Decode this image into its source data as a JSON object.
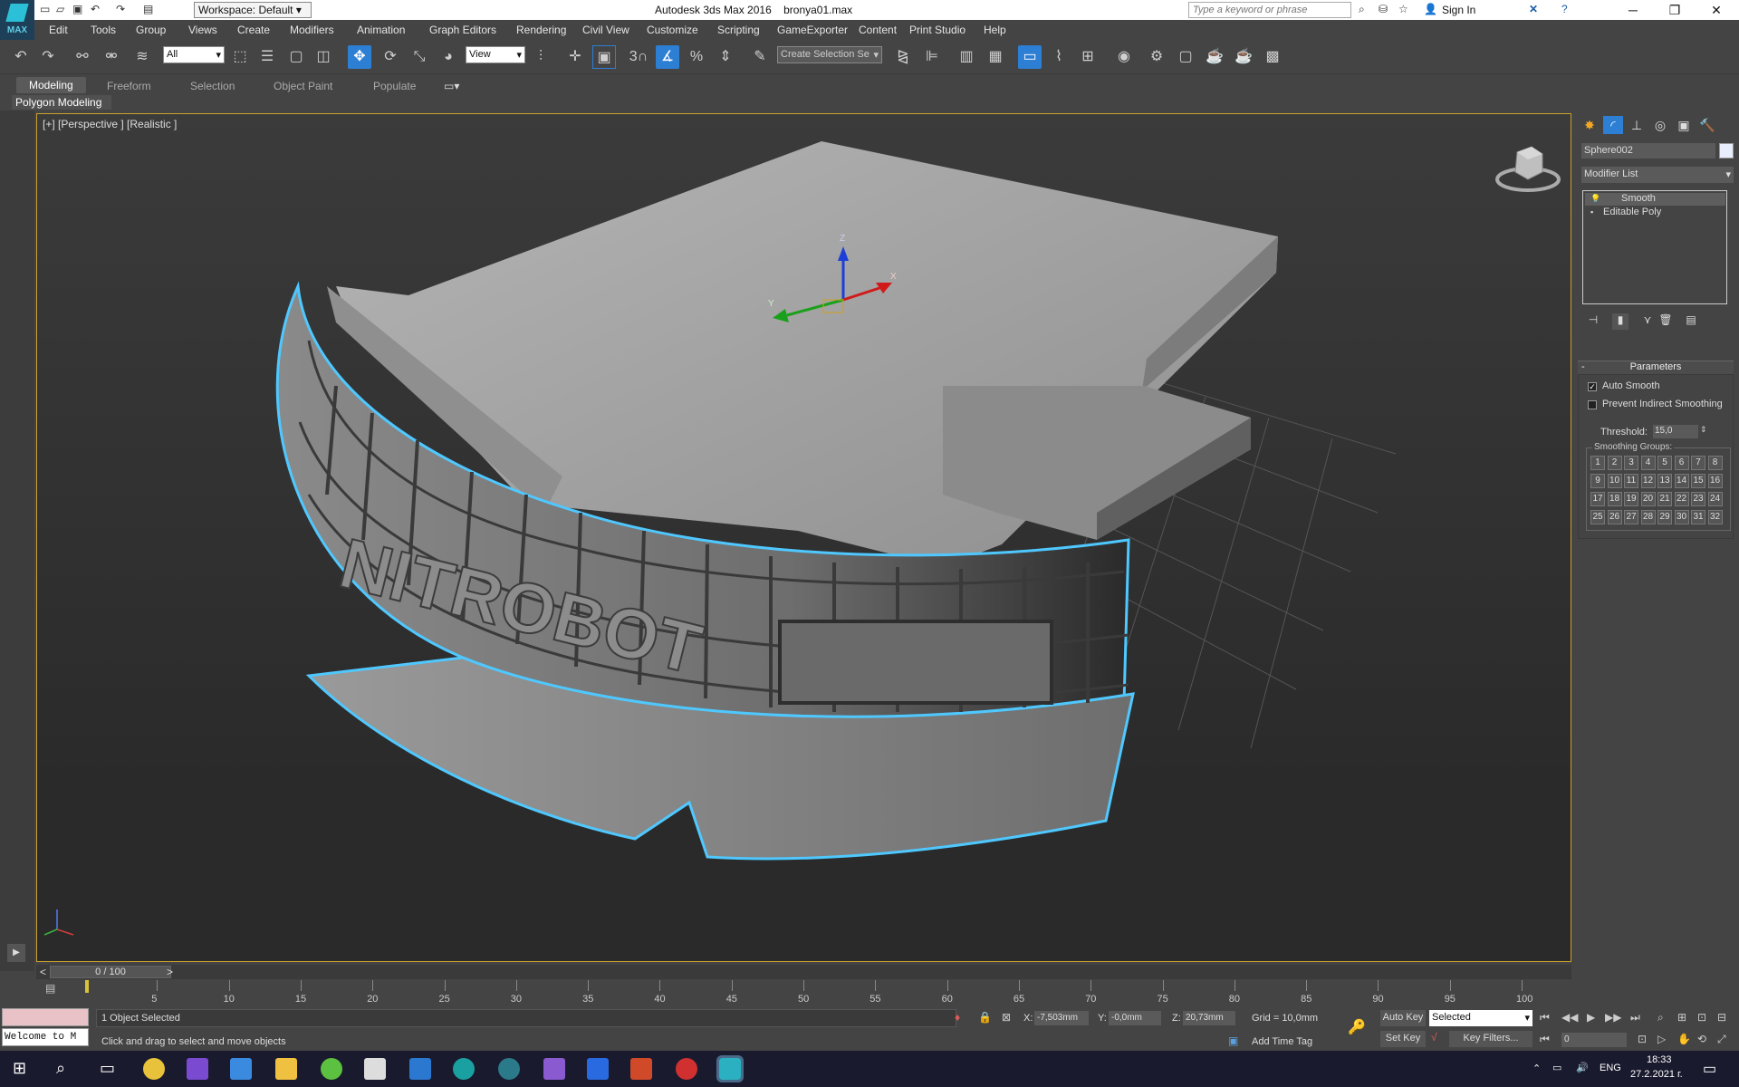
{
  "titlebar": {
    "logo_text": "MAX",
    "workspace": "Workspace: Default",
    "app_title": "Autodesk 3ds Max 2016",
    "file_name": "bronya01.max",
    "search_placeholder": "Type a keyword or phrase",
    "sign_in": "Sign In"
  },
  "menu": [
    "Edit",
    "Tools",
    "Group",
    "Views",
    "Create",
    "Modifiers",
    "Animation",
    "Graph Editors",
    "Rendering",
    "Civil View",
    "Customize",
    "Scripting",
    "GameExporter",
    "Content",
    "Print Studio",
    "Help"
  ],
  "toolbar": {
    "selection_filter": "All",
    "ref_coord": "View",
    "snap_label": "3",
    "named_selection": "Create Selection Se"
  },
  "ribbon": {
    "tabs": [
      "Modeling",
      "Freeform",
      "Selection",
      "Object Paint",
      "Populate"
    ],
    "active_tab": "Modeling",
    "sub_label": "Polygon Modeling"
  },
  "viewport": {
    "label": "[+] [Perspective ] [Realistic ]",
    "model_text": "NITROBOT",
    "gizmo_x": "X",
    "gizmo_y": "Y",
    "gizmo_z": "Z"
  },
  "command_panel": {
    "object_name": "Sphere002",
    "modifier_list": "Modifier List",
    "stack": [
      {
        "label": "Smooth",
        "selected": true
      },
      {
        "label": "Editable Poly",
        "selected": false
      }
    ],
    "rollout_title": "Parameters",
    "auto_smooth_label": "Auto Smooth",
    "auto_smooth_checked": true,
    "prevent_label": "Prevent Indirect Smoothing",
    "prevent_checked": false,
    "threshold_label": "Threshold:",
    "threshold_value": "15,0",
    "smoothing_groups_label": "Smoothing Groups:",
    "smoothing_groups": [
      "1",
      "2",
      "3",
      "4",
      "5",
      "6",
      "7",
      "8",
      "9",
      "10",
      "11",
      "12",
      "13",
      "14",
      "15",
      "16",
      "17",
      "18",
      "19",
      "20",
      "21",
      "22",
      "23",
      "24",
      "25",
      "26",
      "27",
      "28",
      "29",
      "30",
      "31",
      "32"
    ]
  },
  "timeline": {
    "slider_text": "0 / 100",
    "prev": "<",
    "next": ">",
    "ticks": [
      "5",
      "10",
      "15",
      "20",
      "25",
      "30",
      "35",
      "40",
      "45",
      "50",
      "55",
      "60",
      "65",
      "70",
      "75",
      "80",
      "85",
      "90",
      "95",
      "100"
    ]
  },
  "status": {
    "maxscript_text": "Welcome to M",
    "selected_text": "1 Object Selected",
    "prompt_text": "Click and drag to select and move objects",
    "x_label": "X:",
    "x_value": "-7,503mm",
    "y_label": "Y:",
    "y_value": "-0,0mm",
    "z_label": "Z:",
    "z_value": "20,73mm",
    "grid": "Grid = 10,0mm",
    "add_time_tag": "Add Time Tag",
    "auto_key": "Auto Key",
    "set_key": "Set Key",
    "selected_dropdown": "Selected",
    "key_filters": "Key Filters...",
    "frame_value": "0"
  },
  "taskbar": {
    "lang": "ENG",
    "time": "18:33",
    "date": "27.2.2021 г."
  },
  "colors": {
    "accent": "#2d7fd4",
    "selection_outline": "#4fc8ff",
    "viewport_border": "#c9a22c"
  }
}
